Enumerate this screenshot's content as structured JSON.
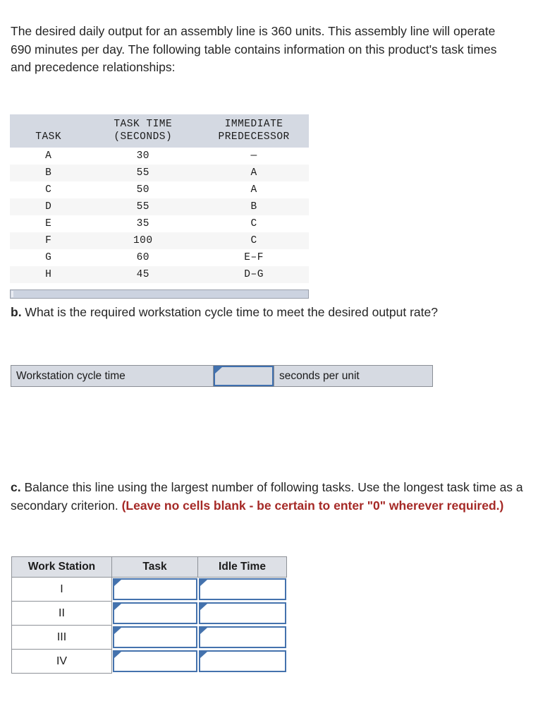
{
  "intro": {
    "text": "The desired daily output for an assembly line is 360 units. This assembly line will operate 690 minutes per day. The following table contains information on this product's task times and precedence relationships:",
    "daily_output_units": "360",
    "operating_minutes_per_day": "690"
  },
  "task_table": {
    "headers": {
      "task": [
        "",
        "TASK"
      ],
      "task_time": [
        "TASK TIME",
        "(SECONDS)"
      ],
      "predecessor": [
        "IMMEDIATE",
        "PREDECESSOR"
      ]
    },
    "rows": [
      {
        "task": "A",
        "time": "30",
        "predecessor": "—"
      },
      {
        "task": "B",
        "time": "55",
        "predecessor": "A"
      },
      {
        "task": "C",
        "time": "50",
        "predecessor": "A"
      },
      {
        "task": "D",
        "time": "55",
        "predecessor": "B"
      },
      {
        "task": "E",
        "time": "35",
        "predecessor": "C"
      },
      {
        "task": "F",
        "time": "100",
        "predecessor": "C"
      },
      {
        "task": "G",
        "time": "60",
        "predecessor": "E–F"
      },
      {
        "task": "H",
        "time": "45",
        "predecessor": "D–G"
      }
    ]
  },
  "question_b": {
    "label": "b.",
    "text": " What is the required workstation cycle time to meet the desired output rate?",
    "answer_row": {
      "label": "Workstation cycle time",
      "value": "",
      "placeholder": "",
      "unit": "seconds per unit"
    }
  },
  "question_c": {
    "label": "c.",
    "text": " Balance this line using the largest number of following tasks. Use the longest task time as a secondary criterion. ",
    "warning": "(Leave no cells blank - be certain to enter \"0\" wherever required.)",
    "balance_table": {
      "headers": [
        "Work Station",
        "Task",
        "Idle Time"
      ],
      "rows": [
        {
          "station": "I",
          "task": "",
          "idle_time": ""
        },
        {
          "station": "II",
          "task": "",
          "idle_time": ""
        },
        {
          "station": "III",
          "task": "",
          "idle_time": ""
        },
        {
          "station": "IV",
          "task": "",
          "idle_time": ""
        }
      ]
    }
  },
  "colors": {
    "table_header_bg": "#d4d9e2",
    "balance_header_bg": "#dde0e6",
    "input_border": "#4472ad",
    "warning_text": "#a52926",
    "strip_bg": "#d6dae2",
    "footer_bar": "#ccd3e0"
  }
}
